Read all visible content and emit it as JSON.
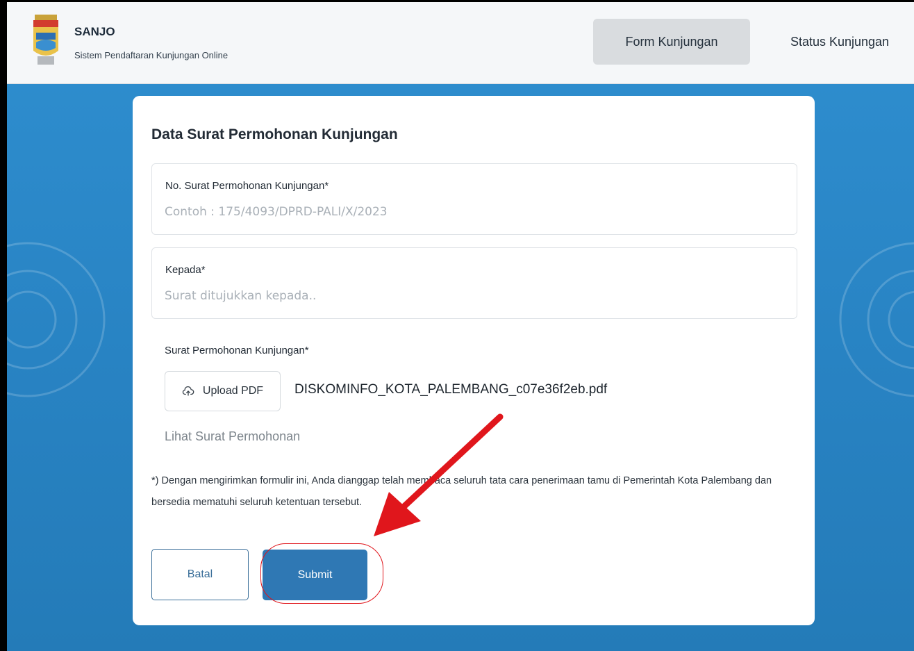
{
  "header": {
    "brand_title": "SANJO",
    "brand_subtitle": "Sistem Pendaftaran Kunjungan Online",
    "nav": {
      "form_label": "Form Kunjungan",
      "status_label": "Status Kunjungan"
    }
  },
  "form": {
    "title": "Data Surat Permohonan Kunjungan",
    "no_surat": {
      "label": "No. Surat Permohonan Kunjungan*",
      "placeholder": "Contoh : 175/4093/DPRD-PALI/X/2023",
      "value": ""
    },
    "kepada": {
      "label": "Kepada*",
      "placeholder": "Surat ditujukkan kepada..",
      "value": ""
    },
    "upload": {
      "label": "Surat Permohonan Kunjungan*",
      "button_label": "Upload PDF",
      "file_name": "DISKOMINFO_KOTA_PALEMBANG_c07e36f2eb.pdf",
      "view_link": "Lihat Surat Permohonan"
    },
    "disclaimer": "*) Dengan mengirimkan formulir ini, Anda dianggap telah membaca seluruh tata cara penerimaan tamu di Pemerintah Kota Palembang dan bersedia mematuhi seluruh ketentuan tersebut.",
    "cancel_label": "Batal",
    "submit_label": "Submit"
  },
  "colors": {
    "background": "#2a86c4",
    "primary": "#2f78b4",
    "annotation": "#e0161c"
  },
  "icons": {
    "upload": "cloud-upload-icon",
    "logo": "city-emblem-logo"
  }
}
